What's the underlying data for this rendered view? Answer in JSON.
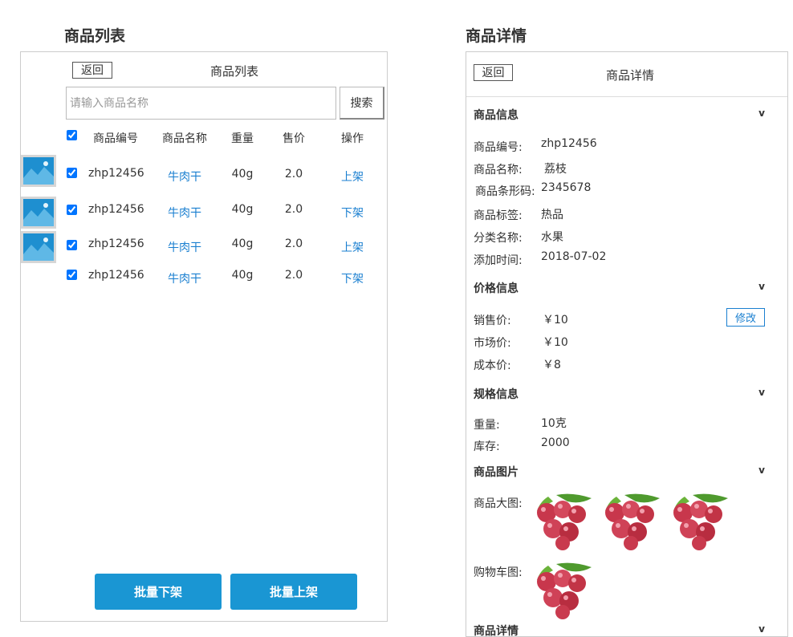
{
  "left": {
    "section_title": "商品列表",
    "back_label": "返回",
    "title": "商品列表",
    "search": {
      "placeholder": "请输入商品名称",
      "value": "",
      "button_label": "搜索"
    },
    "columns": [
      "商品编号",
      "商品名称",
      "重量",
      "售价",
      "操作"
    ],
    "rows": [
      {
        "code": "zhp12456",
        "name": "牛肉干",
        "weight": "40g",
        "price": "2.0",
        "action": "上架",
        "checked": true,
        "has_image": true
      },
      {
        "code": "zhp12456",
        "name": "牛肉干",
        "weight": "40g",
        "price": "2.0",
        "action": "下架",
        "checked": true,
        "has_image": true
      },
      {
        "code": "zhp12456",
        "name": "牛肉干",
        "weight": "40g",
        "price": "2.0",
        "action": "上架",
        "checked": true,
        "has_image": true
      },
      {
        "code": "zhp12456",
        "name": "牛肉干",
        "weight": "40g",
        "price": "2.0",
        "action": "下架",
        "checked": true,
        "has_image": false
      }
    ],
    "bulk_off_label": "批量下架",
    "bulk_on_label": "批量上架"
  },
  "right": {
    "section_title": "商品详情",
    "back_label": "返回",
    "title": "商品详情",
    "chevron": "v",
    "info": {
      "heading": "商品信息",
      "fields": [
        {
          "label": "商品编号:",
          "value": "zhp12456"
        },
        {
          "label": "商品名称:",
          "value": "荔枝"
        },
        {
          "label": "商品条形码:",
          "value": "2345678"
        },
        {
          "label": "商品标签:",
          "value": "热品"
        },
        {
          "label": "分类名称:",
          "value": "水果"
        },
        {
          "label": "添加时间:",
          "value": "2018-07-02"
        }
      ]
    },
    "price": {
      "heading": "价格信息",
      "edit_label": "修改",
      "fields": [
        {
          "label": "销售价:",
          "value": "￥10"
        },
        {
          "label": "市场价:",
          "value": "￥10"
        },
        {
          "label": "成本价:",
          "value": "￥8"
        }
      ]
    },
    "spec": {
      "heading": "规格信息",
      "fields": [
        {
          "label": "重量:",
          "value": "10克"
        },
        {
          "label": "库存:",
          "value": "2000"
        }
      ]
    },
    "images": {
      "heading": "商品图片",
      "large_label": "商品大图:",
      "cart_label": "购物车图:"
    },
    "detail_heading": "商品详情"
  },
  "colors": {
    "accent": "#1a96d3",
    "link": "#1a7fd0",
    "border": "#cccccc"
  }
}
